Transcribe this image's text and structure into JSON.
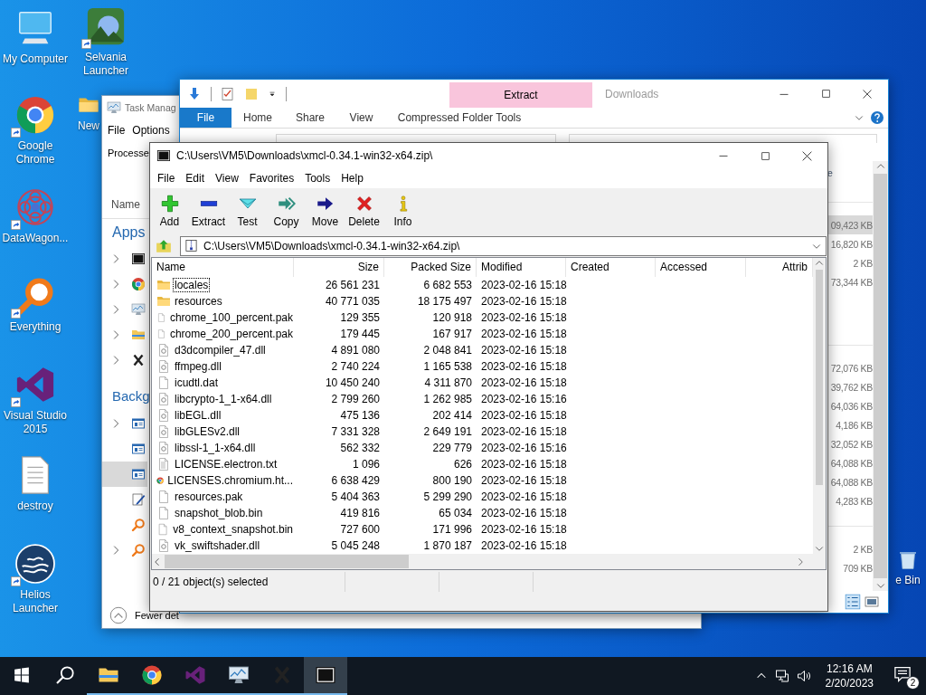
{
  "desktop_icons": [
    {
      "label": "My Computer",
      "kind": "computer",
      "shortcut": false
    },
    {
      "label": "Selvania Launcher",
      "kind": "game",
      "shortcut": true
    },
    {
      "label": "Google Chrome",
      "kind": "browser",
      "shortcut": true
    },
    {
      "label": "New",
      "kind": "folder",
      "shortcut": false
    },
    {
      "label": "DataWagon...",
      "kind": "mandala",
      "shortcut": true
    },
    {
      "label": "Everything",
      "kind": "magnifier",
      "shortcut": true
    },
    {
      "label": "Visual Studio 2015",
      "kind": "loop",
      "shortcut": true
    },
    {
      "label": "destroy",
      "kind": "document",
      "shortcut": false
    },
    {
      "label": "Helios Launcher",
      "kind": "waves",
      "shortcut": true
    },
    {
      "label": "e Bin",
      "kind": "trash",
      "shortcut": false
    }
  ],
  "task_manager": {
    "title": "Task Manag",
    "menu": [
      "File",
      "Options"
    ],
    "tab": "Processe",
    "column": "Name",
    "groups": [
      {
        "label": "Apps",
        "rows": [
          {
            "kind": "archive",
            "expandable": true,
            "selected": false
          },
          {
            "kind": "browser",
            "expandable": true,
            "selected": false
          },
          {
            "kind": "taskmgr",
            "expandable": true,
            "selected": false
          },
          {
            "kind": "explorer",
            "expandable": true,
            "selected": false
          },
          {
            "kind": "x",
            "expandable": true,
            "selected": false
          }
        ]
      },
      {
        "label": "Backg",
        "rows": [
          {
            "kind": "window",
            "expandable": true,
            "selected": false
          },
          {
            "kind": "window",
            "expandable": false,
            "selected": false
          },
          {
            "kind": "window",
            "expandable": false,
            "selected": true
          },
          {
            "kind": "edit",
            "expandable": false,
            "selected": false
          },
          {
            "kind": "magnifier",
            "expandable": false,
            "selected": false
          },
          {
            "kind": "magnifier",
            "expandable": true,
            "selected": false
          }
        ]
      }
    ],
    "footer": "Fewer det"
  },
  "explorer": {
    "title": "Downloads",
    "context_tab": "Extract",
    "ribbon_tabs": [
      {
        "label": "File",
        "kind": "file"
      },
      {
        "label": "Home",
        "kind": "tab"
      },
      {
        "label": "Share",
        "kind": "tab"
      },
      {
        "label": "View",
        "kind": "tab"
      },
      {
        "label": "Compressed Folder Tools",
        "kind": "context"
      }
    ],
    "column": "e",
    "groups": [
      {
        "rows": [
          {
            "size": "09,423 KB",
            "selected": true
          },
          {
            "size": "16,820 KB",
            "selected": false
          },
          {
            "size": "2 KB",
            "selected": false
          },
          {
            "size": "73,344 KB",
            "selected": false
          }
        ]
      },
      {
        "rows": [
          {
            "size": "72,076 KB",
            "selected": false
          },
          {
            "size": "39,762 KB",
            "selected": false
          },
          {
            "size": "64,036 KB",
            "selected": false
          },
          {
            "size": "4,186 KB",
            "selected": false
          },
          {
            "size": "32,052 KB",
            "selected": false
          },
          {
            "size": "64,088 KB",
            "selected": false
          },
          {
            "size": "64,088 KB",
            "selected": false
          },
          {
            "size": "4,283 KB",
            "selected": false
          }
        ]
      },
      {
        "rows": [
          {
            "size": "2 KB",
            "selected": false
          },
          {
            "size": "709 KB",
            "selected": false
          }
        ]
      }
    ]
  },
  "archive_window": {
    "title": "C:\\Users\\VM5\\Downloads\\xmcl-0.34.1-win32-x64.zip\\",
    "menu": [
      "File",
      "Edit",
      "View",
      "Favorites",
      "Tools",
      "Help"
    ],
    "toolbar": [
      {
        "label": "Add",
        "kind": "add"
      },
      {
        "label": "Extract",
        "kind": "extract"
      },
      {
        "label": "Test",
        "kind": "test"
      },
      {
        "label": "Copy",
        "kind": "copy"
      },
      {
        "label": "Move",
        "kind": "move"
      },
      {
        "label": "Delete",
        "kind": "delete"
      },
      {
        "label": "Info",
        "kind": "info"
      }
    ],
    "path": "C:\\Users\\VM5\\Downloads\\xmcl-0.34.1-win32-x64.zip\\",
    "columns": [
      "Name",
      "Size",
      "Packed Size",
      "Modified",
      "Created",
      "Accessed",
      "Attrib"
    ],
    "rows": [
      {
        "name": "locales",
        "size": "26 561 231",
        "packed": "6 682 553",
        "modified": "2023-02-16 15:18",
        "kind": "folder",
        "focused": true
      },
      {
        "name": "resources",
        "size": "40 771 035",
        "packed": "18 175 497",
        "modified": "2023-02-16 15:18",
        "kind": "folder",
        "focused": false
      },
      {
        "name": "chrome_100_percent.pak",
        "size": "129 355",
        "packed": "120 918",
        "modified": "2023-02-16 15:18",
        "kind": "file",
        "focused": false
      },
      {
        "name": "chrome_200_percent.pak",
        "size": "179 445",
        "packed": "167 917",
        "modified": "2023-02-16 15:18",
        "kind": "file",
        "focused": false
      },
      {
        "name": "d3dcompiler_47.dll",
        "size": "4 891 080",
        "packed": "2 048 841",
        "modified": "2023-02-16 15:18",
        "kind": "dll",
        "focused": false
      },
      {
        "name": "ffmpeg.dll",
        "size": "2 740 224",
        "packed": "1 165 538",
        "modified": "2023-02-16 15:18",
        "kind": "dll",
        "focused": false
      },
      {
        "name": "icudtl.dat",
        "size": "10 450 240",
        "packed": "4 311 870",
        "modified": "2023-02-16 15:18",
        "kind": "file",
        "focused": false
      },
      {
        "name": "libcrypto-1_1-x64.dll",
        "size": "2 799 260",
        "packed": "1 262 985",
        "modified": "2023-02-16 15:16",
        "kind": "dll",
        "focused": false
      },
      {
        "name": "libEGL.dll",
        "size": "475 136",
        "packed": "202 414",
        "modified": "2023-02-16 15:18",
        "kind": "dll",
        "focused": false
      },
      {
        "name": "libGLESv2.dll",
        "size": "7 331 328",
        "packed": "2 649 191",
        "modified": "2023-02-16 15:18",
        "kind": "dll",
        "focused": false
      },
      {
        "name": "libssl-1_1-x64.dll",
        "size": "562 332",
        "packed": "229 779",
        "modified": "2023-02-16 15:16",
        "kind": "dll",
        "focused": false
      },
      {
        "name": "LICENSE.electron.txt",
        "size": "1 096",
        "packed": "626",
        "modified": "2023-02-16 15:18",
        "kind": "text",
        "focused": false
      },
      {
        "name": "LICENSES.chromium.ht...",
        "size": "6 638 429",
        "packed": "800 190",
        "modified": "2023-02-16 15:18",
        "kind": "browser",
        "focused": false
      },
      {
        "name": "resources.pak",
        "size": "5 404 363",
        "packed": "5 299 290",
        "modified": "2023-02-16 15:18",
        "kind": "file",
        "focused": false
      },
      {
        "name": "snapshot_blob.bin",
        "size": "419 816",
        "packed": "65 034",
        "modified": "2023-02-16 15:18",
        "kind": "file",
        "focused": false
      },
      {
        "name": "v8_context_snapshot.bin",
        "size": "727 600",
        "packed": "171 996",
        "modified": "2023-02-16 15:18",
        "kind": "file",
        "focused": false
      },
      {
        "name": "vk_swiftshader.dll",
        "size": "5 045 248",
        "packed": "1 870 187",
        "modified": "2023-02-16 15:18",
        "kind": "dll",
        "focused": false
      }
    ],
    "status": "0 / 21 object(s) selected"
  },
  "taskbar": {
    "items": [
      {
        "kind": "start",
        "running": false,
        "selected": false
      },
      {
        "kind": "search",
        "running": false,
        "selected": false
      },
      {
        "kind": "explorer",
        "running": true,
        "selected": false
      },
      {
        "kind": "browser",
        "running": true,
        "selected": false
      },
      {
        "kind": "loop",
        "running": true,
        "selected": false
      },
      {
        "kind": "taskmgr",
        "running": true,
        "selected": false
      },
      {
        "kind": "x",
        "running": true,
        "selected": false
      },
      {
        "kind": "archive",
        "running": true,
        "selected": true
      }
    ],
    "time": "12:16 AM",
    "date": "2/20/2023",
    "notifications": "2"
  }
}
